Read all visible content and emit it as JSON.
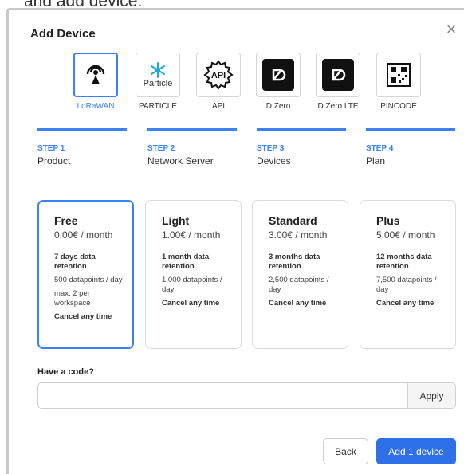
{
  "background_text": "and add device.",
  "dialog": {
    "title": "Add Device",
    "close_label": "×"
  },
  "devices": [
    {
      "label": "LoRaWAN",
      "icon": "lorawan-antenna-icon",
      "selected": true
    },
    {
      "label": "PARTICLE",
      "icon": "particle-logo-icon",
      "sublabel": "Particle",
      "selected": false
    },
    {
      "label": "API",
      "icon": "api-gear-icon",
      "selected": false
    },
    {
      "label": "D Zero",
      "icon": "dzero-logo-icon",
      "selected": false
    },
    {
      "label": "D Zero LTE",
      "icon": "dzero-lte-logo-icon",
      "selected": false
    },
    {
      "label": "PINCODE",
      "icon": "qr-code-icon",
      "selected": false
    }
  ],
  "steps": [
    {
      "number": "STEP 1",
      "name": "Product"
    },
    {
      "number": "STEP 2",
      "name": "Network Server"
    },
    {
      "number": "STEP 3",
      "name": "Devices"
    },
    {
      "number": "STEP 4",
      "name": "Plan"
    }
  ],
  "plans": [
    {
      "name": "Free",
      "price": "0.00€ / month",
      "retention": "7 days data retention",
      "datapoints": "500 datapoints / day",
      "extra": "max. 2 per workspace",
      "cancel": "Cancel any time",
      "selected": true
    },
    {
      "name": "Light",
      "price": "1.00€ / month",
      "retention": "1 month data retention",
      "datapoints": "1,000 datapoints / day",
      "cancel": "Cancel any time",
      "selected": false
    },
    {
      "name": "Standard",
      "price": "3.00€ / month",
      "retention": "3 months data retention",
      "datapoints": "2,500 datapoints / day",
      "cancel": "Cancel any time",
      "selected": false
    },
    {
      "name": "Plus",
      "price": "5.00€ / month",
      "retention": "12 months data retention",
      "datapoints": "7,500 datapoints / day",
      "cancel": "Cancel any time",
      "selected": false
    }
  ],
  "code": {
    "label": "Have a code?",
    "value": "",
    "apply_label": "Apply"
  },
  "footer": {
    "back_label": "Back",
    "add_label": "Add 1 device"
  },
  "colors": {
    "accent": "#3b82f6",
    "primary_button": "#2f6fe8"
  }
}
